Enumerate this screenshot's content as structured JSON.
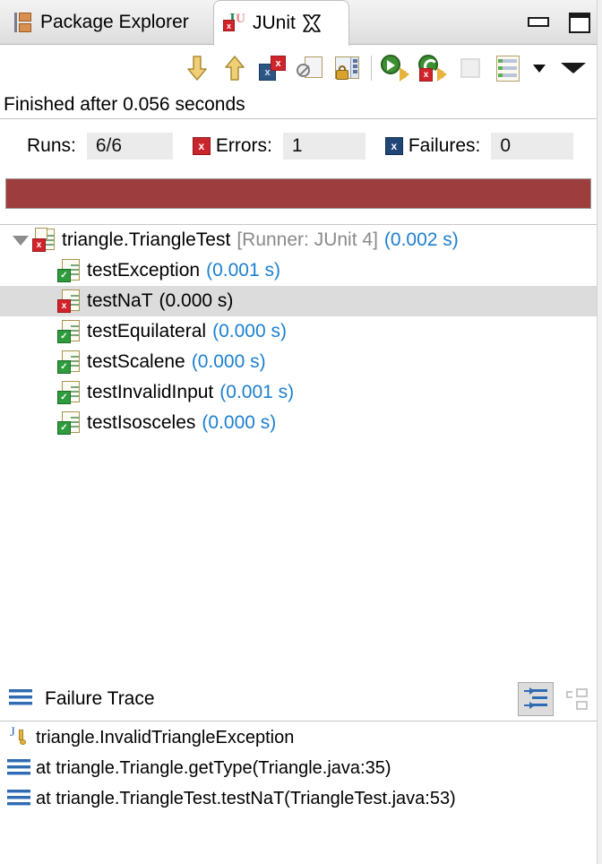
{
  "window": {
    "minimize_icon": "minimize-icon",
    "maximize_icon": "maximize-icon"
  },
  "tabs": [
    {
      "label": "Package Explorer",
      "icon": "package-explorer-icon",
      "active": false
    },
    {
      "label": "JUnit",
      "icon": "junit-icon",
      "active": true,
      "close_icon": "close-icon"
    }
  ],
  "toolbar": {
    "buttons": [
      {
        "name": "next-failure-button",
        "icon": "arrow-down-icon",
        "label": "Next Failure"
      },
      {
        "name": "previous-failure-button",
        "icon": "arrow-up-icon",
        "label": "Previous Failure"
      },
      {
        "name": "show-failures-only-button",
        "icon": "failures-filter-icon",
        "label": "Show Failures Only"
      },
      {
        "name": "show-ignored-button",
        "icon": "ignored-tests-icon",
        "label": "Show Tests in Hierarchy"
      },
      {
        "name": "scroll-lock-button",
        "icon": "scroll-lock-icon",
        "label": "Scroll Lock"
      },
      {
        "name": "rerun-test-button",
        "icon": "rerun-icon",
        "label": "Rerun Test"
      },
      {
        "name": "rerun-failed-button",
        "icon": "rerun-failed-icon",
        "label": "Rerun Test - Failures First"
      },
      {
        "name": "stop-button",
        "icon": "stop-icon",
        "label": "Stop JUnit Test Run"
      },
      {
        "name": "test-history-button",
        "icon": "test-history-icon",
        "label": "Test Run History"
      },
      {
        "name": "view-menu-button",
        "icon": "view-menu-icon",
        "label": "View Menu"
      }
    ],
    "history_dropdown_icon": "chevron-down-icon"
  },
  "status": {
    "text": "Finished after 0.056 seconds"
  },
  "counters": {
    "runs_label": "Runs:",
    "runs_value": "6/6",
    "errors_label": "Errors:",
    "errors_value": "1",
    "errors_icon": "error-x-icon",
    "failures_label": "Failures:",
    "failures_value": "0",
    "failures_icon": "failure-x-icon"
  },
  "progress": {
    "percent": 100,
    "color": "#9e3d3d",
    "state": "failed"
  },
  "tree": {
    "root": {
      "name": "triangle.TriangleTest",
      "runner": "[Runner: JUnit 4]",
      "time": "(0.002 s)",
      "status": "fail",
      "expanded": true,
      "expander_icon": "chevron-down-icon"
    },
    "tests": [
      {
        "name": "testException",
        "time": "(0.001 s)",
        "status": "pass",
        "selected": false
      },
      {
        "name": "testNaT",
        "time": "(0.000 s)",
        "status": "fail",
        "selected": true
      },
      {
        "name": "testEquilateral",
        "time": "(0.000 s)",
        "status": "pass",
        "selected": false
      },
      {
        "name": "testScalene",
        "time": "(0.000 s)",
        "status": "pass",
        "selected": false
      },
      {
        "name": "testInvalidInput",
        "time": "(0.001 s)",
        "status": "pass",
        "selected": false
      },
      {
        "name": "testIsosceles",
        "time": "(0.000 s)",
        "status": "pass",
        "selected": false
      }
    ]
  },
  "failure_trace": {
    "title": "Failure Trace",
    "header_icon": "stack-trace-icon",
    "filter_button": "filter-stack-trace-icon",
    "pin_button": "pin-console-icon",
    "entries": [
      {
        "text": "triangle.InvalidTriangleException",
        "icon": "exception-icon"
      },
      {
        "text": "at triangle.Triangle.getType(Triangle.java:35)",
        "icon": "stack-frame-icon"
      },
      {
        "text": "at triangle.TriangleTest.testNaT(TriangleTest.java:53)",
        "icon": "stack-frame-icon"
      }
    ]
  }
}
